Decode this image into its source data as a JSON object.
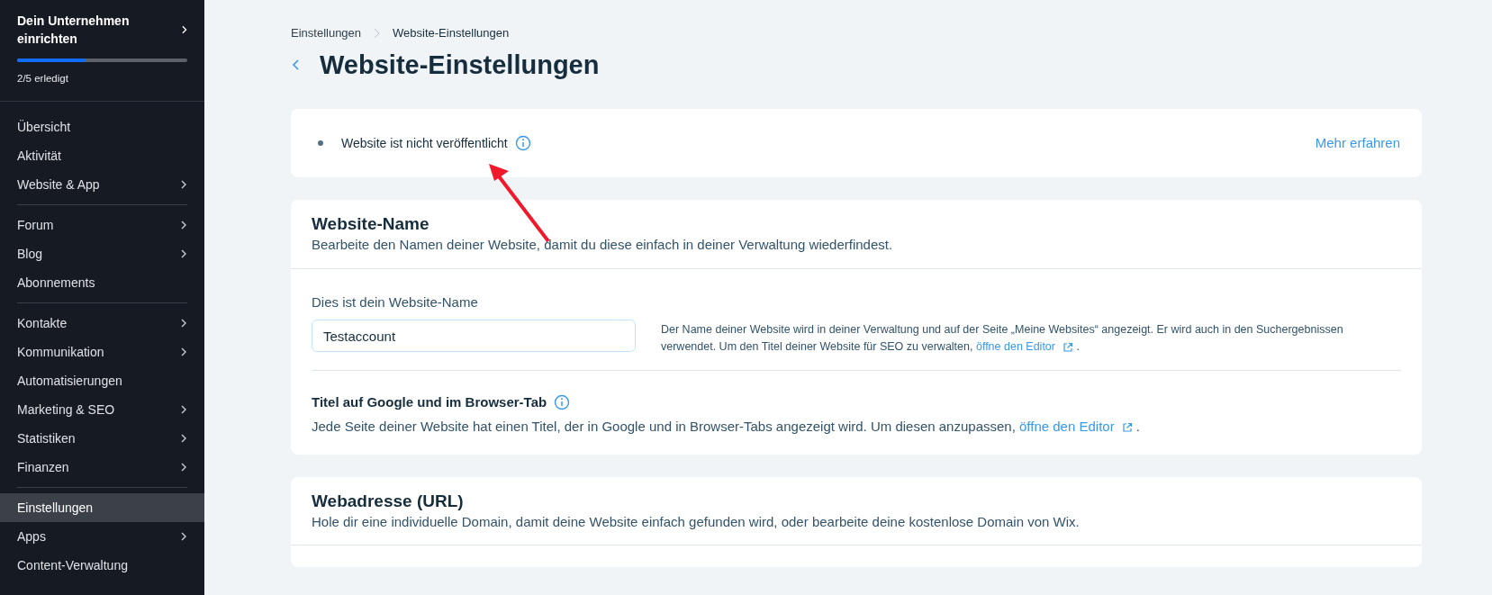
{
  "sidebar": {
    "setup": {
      "title": "Dein Unternehmen einrichten",
      "level": 0.4,
      "progress_text": "2/5 erledigt"
    },
    "groups": [
      [
        {
          "label": "Übersicht",
          "submenu": false,
          "selected": false
        },
        {
          "label": "Aktivität",
          "submenu": false,
          "selected": false
        },
        {
          "label": "Website & App",
          "submenu": true,
          "selected": false
        }
      ],
      [
        {
          "label": "Forum",
          "submenu": true,
          "selected": false
        },
        {
          "label": "Blog",
          "submenu": true,
          "selected": false
        },
        {
          "label": "Abonnements",
          "submenu": false,
          "selected": false
        }
      ],
      [
        {
          "label": "Kontakte",
          "submenu": true,
          "selected": false
        },
        {
          "label": "Kommunikation",
          "submenu": true,
          "selected": false
        },
        {
          "label": "Automatisierungen",
          "submenu": false,
          "selected": false
        },
        {
          "label": "Marketing & SEO",
          "submenu": true,
          "selected": false
        },
        {
          "label": "Statistiken",
          "submenu": true,
          "selected": false
        },
        {
          "label": "Finanzen",
          "submenu": true,
          "selected": false
        }
      ],
      [
        {
          "label": "Einstellungen",
          "submenu": false,
          "selected": true
        },
        {
          "label": "Apps",
          "submenu": true,
          "selected": false
        },
        {
          "label": "Content-Verwaltung",
          "submenu": false,
          "selected": false
        }
      ]
    ]
  },
  "breadcrumb": [
    "Einstellungen",
    "Website-Einstellungen"
  ],
  "page_title": "Website-Einstellungen",
  "status_card": {
    "status": "Website ist nicht veröffentlicht",
    "link": "Mehr erfahren"
  },
  "name_card": {
    "title": "Website-Name",
    "description": "Bearbeite den Namen deiner Website, damit du diese einfach in deiner Verwaltung wiederfindest.",
    "field_label": "Dies ist dein Website-Name",
    "field_value": "Testaccount",
    "help": {
      "before": "Der Name deiner Website wird in deiner Verwaltung und auf der Seite „Meine Websites“ angezeigt. Er wird auch in den Suchergebnissen verwendet. Um den Titel deiner Website für SEO zu verwalten,",
      "link": "öffne den Editor",
      "after": "."
    },
    "subtitle": "Titel auf Google und im Browser-Tab",
    "sub_text": {
      "before": "Jede Seite deiner Website hat einen Titel, der in Google und in Browser-Tabs angezeigt wird. Um diesen anzupassen,",
      "link": "öffne den Editor",
      "after": "."
    }
  },
  "url_card": {
    "title": "Webadresse (URL)",
    "description": "Hole dir eine individuelle Domain, damit deine Website einfach gefunden wird, oder bearbeite deine kostenlose Domain von Wix."
  }
}
